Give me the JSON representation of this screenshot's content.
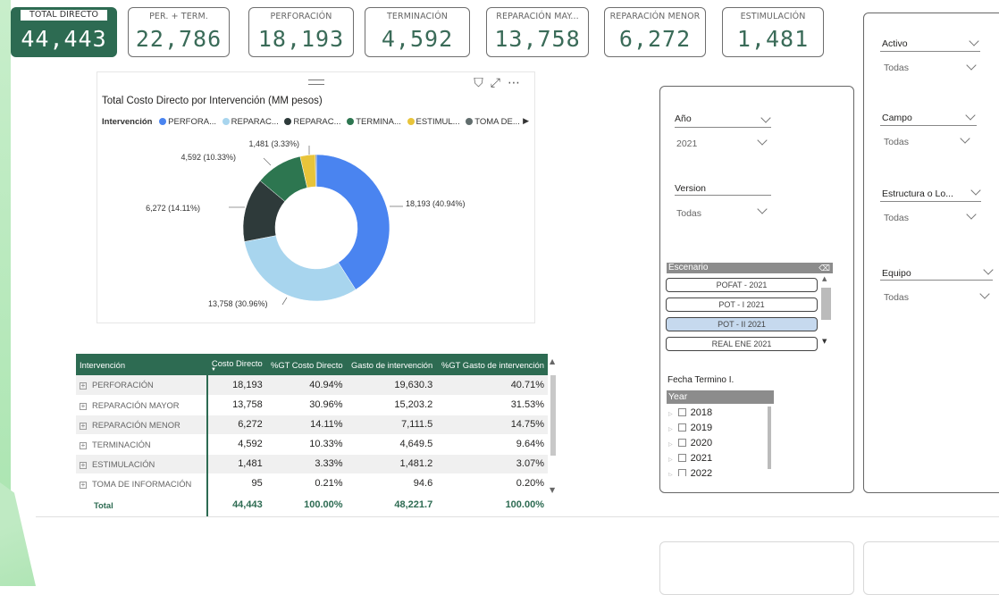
{
  "kpis": [
    {
      "label": "TOTAL DIRECTO",
      "value": "44,443"
    },
    {
      "label": "PER. + TERM.",
      "value": "22,786"
    },
    {
      "label": "PERFORACIÓN",
      "value": "18,193"
    },
    {
      "label": "TERMINACIÓN",
      "value": "4,592"
    },
    {
      "label": "REPARACIÓN MAY...",
      "value": "13,758"
    },
    {
      "label": "REPARACIÓN MENOR",
      "value": "6,272"
    },
    {
      "label": "ESTIMULACIÓN",
      "value": "1,481"
    }
  ],
  "chart_data": {
    "type": "pie",
    "title": "Total Costo Directo por Intervención (MM pesos)",
    "legend_title": "Intervención",
    "legend": [
      "PERFORA...",
      "REPARAC...",
      "REPARAC...",
      "TERMINA...",
      "ESTIMUL...",
      "TOMA DE..."
    ],
    "legend_placement": "top",
    "slices": [
      {
        "label": "18,193 (40.94%)",
        "value": 18193,
        "color": "#4a84f0"
      },
      {
        "label": "13,758 (30.96%)",
        "value": 13758,
        "color": "#a8d5ee"
      },
      {
        "label": "6,272 (14.11%)",
        "value": 6272,
        "color": "#2e3a3a"
      },
      {
        "label": "4,592 (10.33%)",
        "value": 4592,
        "color": "#2d7650"
      },
      {
        "label": "1,481 (3.33%)",
        "value": 1481,
        "color": "#e8c43a"
      },
      {
        "label": "",
        "value": 95,
        "color": "#616d6d"
      }
    ]
  },
  "table": {
    "headers": [
      "Intervención",
      "Costo Directo",
      "%GT Costo Directo",
      "Gasto de intervención",
      "%GT Gasto de intervención"
    ],
    "rows": [
      [
        "PERFORACIÓN",
        "18,193",
        "40.94%",
        "19,630.3",
        "40.71%"
      ],
      [
        "REPARACIÓN MAYOR",
        "13,758",
        "30.96%",
        "15,203.2",
        "31.53%"
      ],
      [
        "REPARACIÓN MENOR",
        "6,272",
        "14.11%",
        "7,111.5",
        "14.75%"
      ],
      [
        "TERMINACIÓN",
        "4,592",
        "10.33%",
        "4,649.5",
        "9.64%"
      ],
      [
        "ESTIMULACIÓN",
        "1,481",
        "3.33%",
        "1,481.2",
        "3.07%"
      ],
      [
        "TOMA DE INFORMACIÓN",
        "95",
        "0.21%",
        "94.6",
        "0.20%"
      ]
    ],
    "total": [
      "Total",
      "44,443",
      "100.00%",
      "48,221.7",
      "100.00%"
    ]
  },
  "filters_mid": {
    "anio_label": "Año",
    "anio_value": "2021",
    "version_label": "Version",
    "version_value": "Todas",
    "escenario_label": "Escenario",
    "escenario_options": [
      "POFAT - 2021",
      "POT - I 2021",
      "POT - II 2021",
      "REAL ENE 2021"
    ],
    "escenario_selected": "POT - II 2021",
    "fecha_label": "Fecha Termino I.",
    "year_label": "Year",
    "years": [
      "2018",
      "2019",
      "2020",
      "2021",
      "2022"
    ]
  },
  "filters_right": [
    {
      "label": "Activo",
      "value": "Todas"
    },
    {
      "label": "Campo",
      "value": "Todas"
    },
    {
      "label": "Estructura o Lo...",
      "value": "Todas"
    },
    {
      "label": "Equipo",
      "value": "Todas"
    }
  ]
}
